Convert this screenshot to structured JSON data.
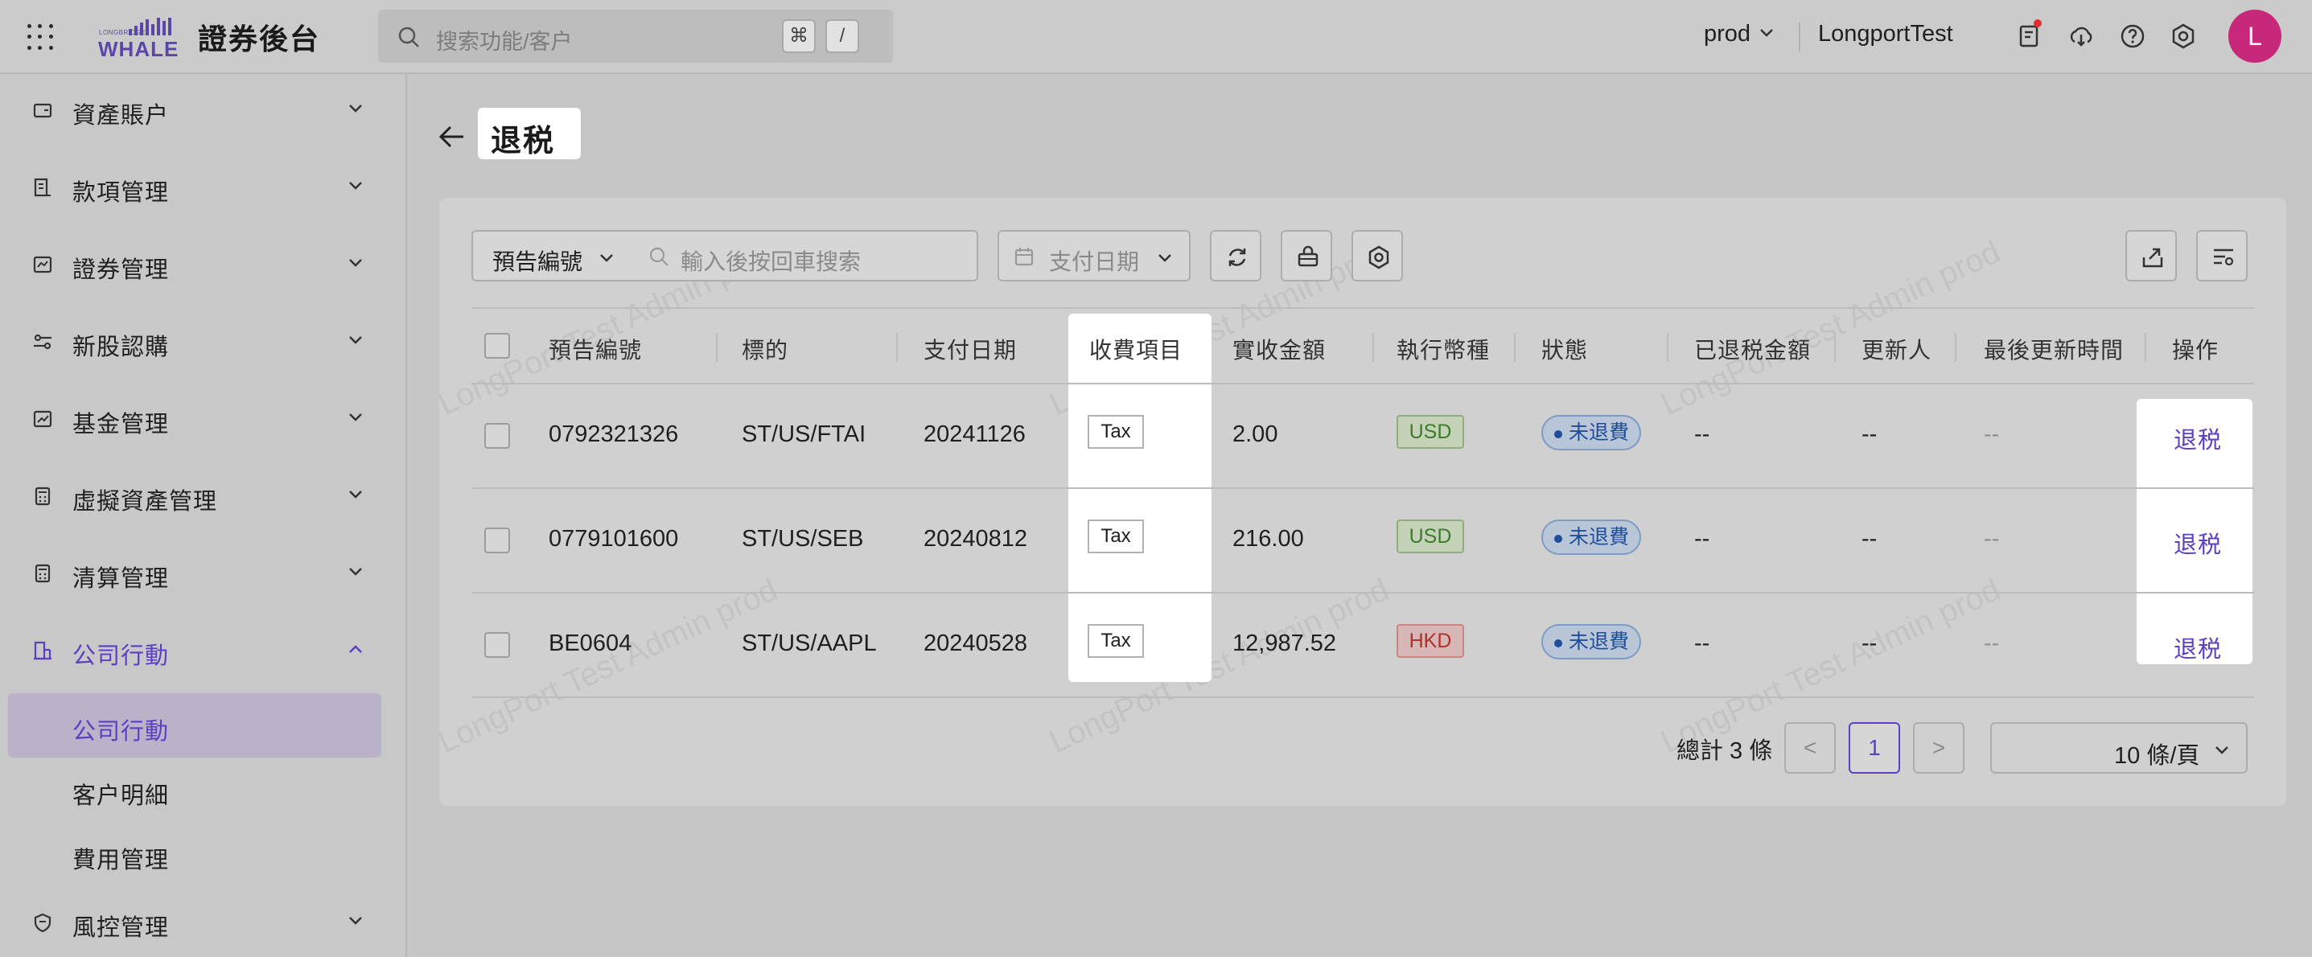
{
  "header": {
    "logo_small": "LONGBRIDGE",
    "logo_word": "WHALE",
    "app_title": "證券後台",
    "search_placeholder": "搜索功能/客户",
    "kbd_cmd": "⌘",
    "kbd_slash": "/",
    "env": "prod",
    "user": "LongportTest",
    "avatar_letter": "L"
  },
  "sidebar": {
    "items": [
      {
        "label": "資產賬户",
        "icon": "wallet-icon"
      },
      {
        "label": "款項管理",
        "icon": "receipt-icon"
      },
      {
        "label": "證券管理",
        "icon": "securities-icon"
      },
      {
        "label": "新股認購",
        "icon": "ipo-icon"
      },
      {
        "label": "基金管理",
        "icon": "fund-chart-icon"
      },
      {
        "label": "虛擬資產管理",
        "icon": "calculator-icon"
      },
      {
        "label": "清算管理",
        "icon": "clearing-icon"
      },
      {
        "label": "公司行動",
        "icon": "building-icon"
      }
    ],
    "sub_items": [
      {
        "label": "公司行動"
      },
      {
        "label": "客户明細"
      },
      {
        "label": "費用管理"
      }
    ],
    "last_item": {
      "label": "風控管理",
      "icon": "shield-icon"
    }
  },
  "page": {
    "title": "退税"
  },
  "toolbar": {
    "field_select": "預告編號",
    "search_placeholder": "輸入後按回車搜索",
    "date_placeholder": "支付日期"
  },
  "table": {
    "headers": [
      "預告編號",
      "標的",
      "支付日期",
      "收費項目",
      "實收金額",
      "執行幣種",
      "狀態",
      "已退税金額",
      "更新人",
      "最後更新時間",
      "操作"
    ],
    "rows": [
      {
        "id": "0792321326",
        "symbol": "ST/US/FTAI",
        "date": "20241126",
        "item": "Tax",
        "amount": "2.00",
        "currency": "USD",
        "status": "未退費",
        "refunded": "--",
        "updater": "--",
        "updated_at": "--",
        "action": "退税"
      },
      {
        "id": "0779101600",
        "symbol": "ST/US/SEB",
        "date": "20240812",
        "item": "Tax",
        "amount": "216.00",
        "currency": "USD",
        "status": "未退費",
        "refunded": "--",
        "updater": "--",
        "updated_at": "--",
        "action": "退税"
      },
      {
        "id": "BE0604",
        "symbol": "ST/US/AAPL",
        "date": "20240528",
        "item": "Tax",
        "amount": "12,987.52",
        "currency": "HKD",
        "status": "未退費",
        "refunded": "--",
        "updater": "--",
        "updated_at": "--",
        "action": "退税"
      }
    ]
  },
  "pager": {
    "total": "總計 3 條",
    "current_page": "1",
    "prev": "<",
    "next": ">",
    "page_size": "10 條/頁"
  },
  "watermark": "LongPort Test Admin prod",
  "colors": {
    "accent": "#5b3fc4",
    "avatar": "#c8287a",
    "usd": "#3d7a2a",
    "hkd": "#b2302a",
    "status": "#1e4e9a"
  }
}
